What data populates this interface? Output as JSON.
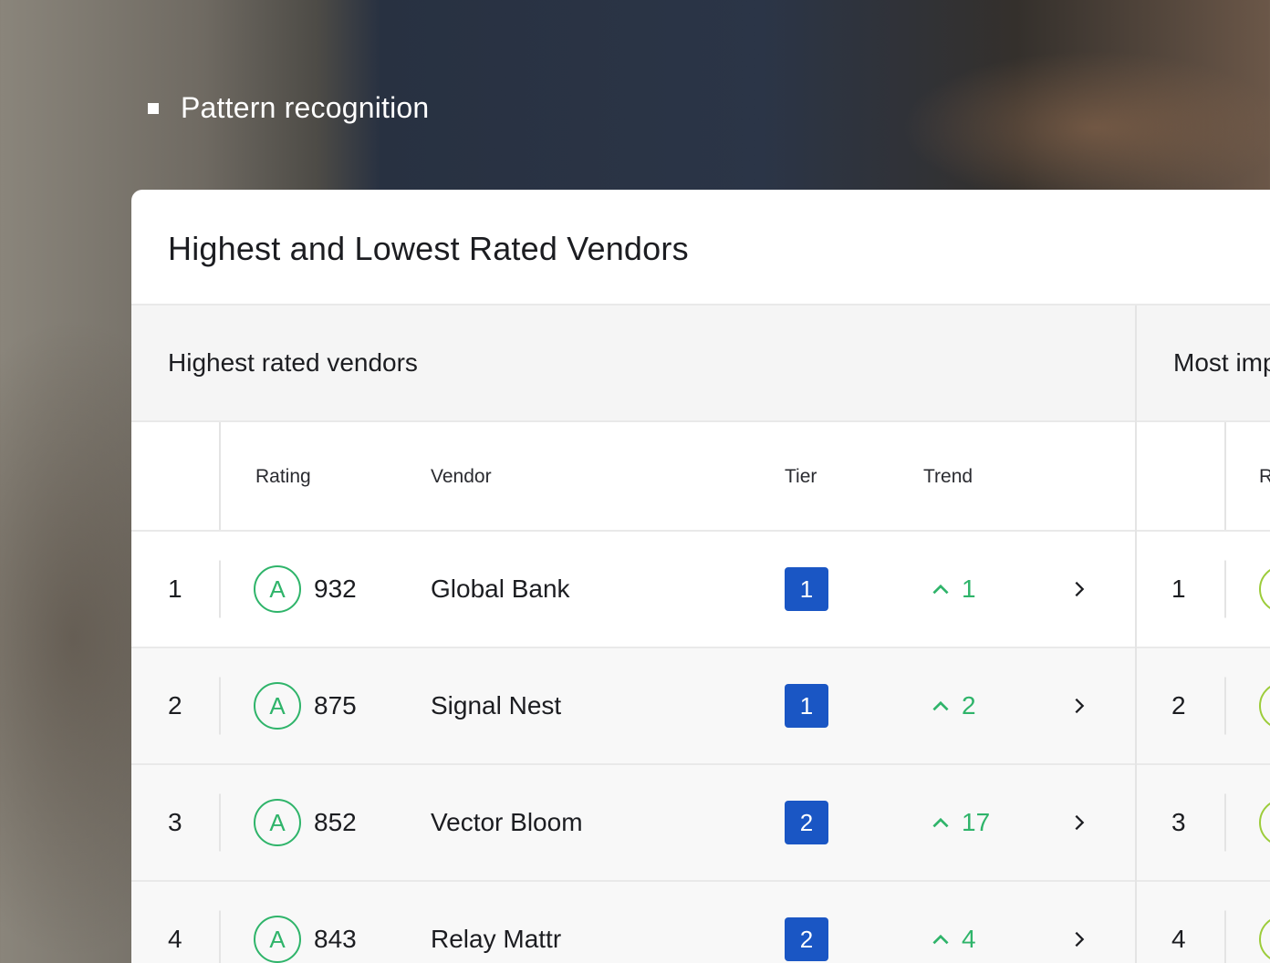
{
  "bullet": {
    "text": "Pattern recognition"
  },
  "card": {
    "title": "Highest and Lowest Rated Vendors",
    "left_section": {
      "heading": "Highest rated vendors",
      "columns": {
        "rank": "",
        "rating": "Rating",
        "vendor": "Vendor",
        "tier": "Tier",
        "trend": "Trend"
      },
      "rows": [
        {
          "rank": "1",
          "grade": "A",
          "score": "932",
          "vendor": "Global Bank",
          "tier": "1",
          "trend": "1"
        },
        {
          "rank": "2",
          "grade": "A",
          "score": "875",
          "vendor": "Signal Nest",
          "tier": "1",
          "trend": "2"
        },
        {
          "rank": "3",
          "grade": "A",
          "score": "852",
          "vendor": "Vector Bloom",
          "tier": "2",
          "trend": "17"
        },
        {
          "rank": "4",
          "grade": "A",
          "score": "843",
          "vendor": "Relay Mattr",
          "tier": "2",
          "trend": "4"
        }
      ]
    },
    "right_section": {
      "heading": "Most imp",
      "columns": {
        "rating": "R"
      },
      "rows": [
        {
          "rank": "1"
        },
        {
          "rank": "2"
        },
        {
          "rank": "3"
        },
        {
          "rank": "4"
        }
      ]
    }
  },
  "colors": {
    "accent_green": "#2fb46a",
    "tier_blue": "#1a56c4",
    "grade_lime": "#9ccc3a"
  }
}
